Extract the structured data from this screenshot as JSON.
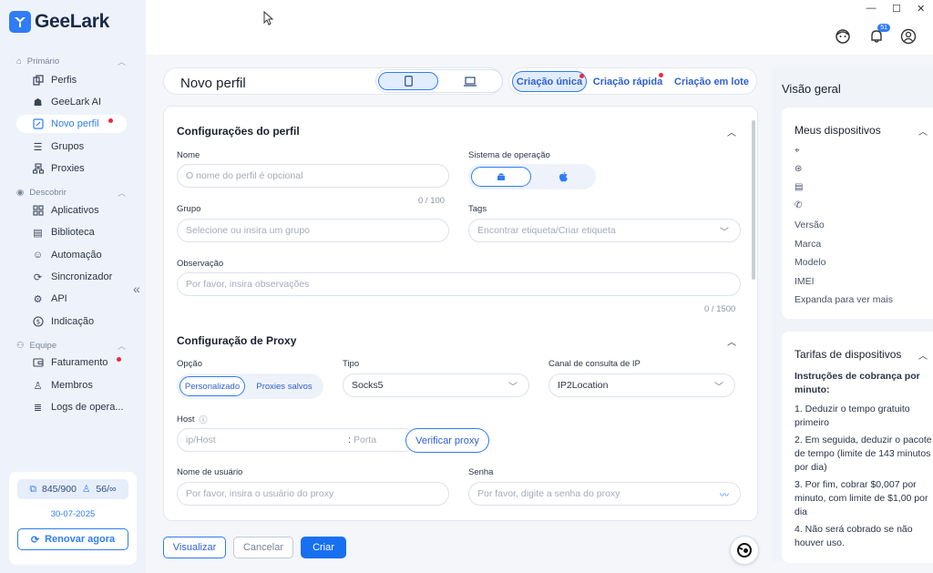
{
  "app": {
    "name": "GeeLark"
  },
  "sidebar": {
    "sections": [
      {
        "label": "Primário",
        "items": [
          {
            "label": "Perfis",
            "icon": "profiles-icon"
          },
          {
            "label": "GeeLark AI",
            "icon": "ai-icon"
          },
          {
            "label": "Novo perfil",
            "icon": "edit-icon",
            "active": true,
            "dot": true
          },
          {
            "label": "Grupos",
            "icon": "list-icon"
          },
          {
            "label": "Proxies",
            "icon": "network-icon"
          }
        ]
      },
      {
        "label": "Descobrir",
        "items": [
          {
            "label": "Aplicativos",
            "icon": "apps-icon"
          },
          {
            "label": "Biblioteca",
            "icon": "library-icon"
          },
          {
            "label": "Automação",
            "icon": "robot-icon"
          },
          {
            "label": "Sincronizador",
            "icon": "sync-icon"
          },
          {
            "label": "API",
            "icon": "api-icon"
          },
          {
            "label": "Indicação",
            "icon": "dollar-icon"
          }
        ]
      },
      {
        "label": "Equipe",
        "items": [
          {
            "label": "Faturamento",
            "icon": "wallet-icon",
            "dot": true
          },
          {
            "label": "Membros",
            "icon": "user-icon"
          },
          {
            "label": "Logs de opera...",
            "icon": "log-icon"
          }
        ]
      }
    ],
    "quota": {
      "devices": "845/900",
      "members": "56/∞"
    },
    "date": "30-07-2025",
    "renew_label": "Renovar agora"
  },
  "topbar": {
    "notification_count": "51"
  },
  "profile_header": {
    "title": "Novo perfil"
  },
  "mode_tabs": [
    {
      "label": "Criação única",
      "selected": true,
      "dot": true
    },
    {
      "label": "Criação rápida",
      "dot": true
    },
    {
      "label": "Criação em lote"
    }
  ],
  "profile_config": {
    "title": "Configurações do perfil",
    "name_label": "Nome",
    "name_placeholder": "O nome do perfil é opcional",
    "name_counter": "0 / 100",
    "os_label": "Sistema de operação",
    "group_label": "Grupo",
    "group_placeholder": "Selecione ou insira um grupo",
    "tags_label": "Tags",
    "tags_placeholder": "Encontrar etiqueta/Criar etiqueta",
    "note_label": "Observação",
    "note_placeholder": "Por favor, insira observações",
    "note_counter": "0 / 1500"
  },
  "proxy_config": {
    "title": "Configuração de Proxy",
    "option_label": "Opção",
    "option_custom": "Personalizado",
    "option_saved": "Proxies salvos",
    "type_label": "Tipo",
    "type_value": "Socks5",
    "ip_channel_label": "Canal de consulta de IP",
    "ip_channel_value": "IP2Location",
    "host_label": "Host",
    "host_placeholder": "ip/Host",
    "port_placeholder": "Porta",
    "port_separator": ":",
    "verify_label": "Verificar proxy",
    "username_label": "Nome de usuário",
    "username_placeholder": "Por favor, insira o usuário do proxy",
    "password_label": "Senha",
    "password_placeholder": "Por favor, digite a senha do proxy"
  },
  "actions": {
    "preview": "Visualizar",
    "cancel": "Cancelar",
    "create": "Criar"
  },
  "overview": {
    "title": "Visão geral",
    "devices_title": "Meus dispositivos",
    "device_fields": [
      "Versão",
      "Marca",
      "Modelo",
      "IMEI",
      "Expanda para ver mais"
    ],
    "rates_title": "Tarifas de dispositivos",
    "billing_heading": "Instruções de cobrança por minuto:",
    "billing_steps": [
      "1. Deduzir o tempo gratuito primeiro",
      "2. Em seguida, deduzir o pacote de tempo (limite de 143 minutos por dia)",
      "3. Por fim, cobrar $0,007 por minuto, com limite de $1,00 por dia",
      "4. Não será cobrado se não houver uso."
    ]
  },
  "colors": {
    "accent": "#2f7cf6",
    "dot": "#f0283c",
    "sidebar_bg": "#eef3fb"
  }
}
